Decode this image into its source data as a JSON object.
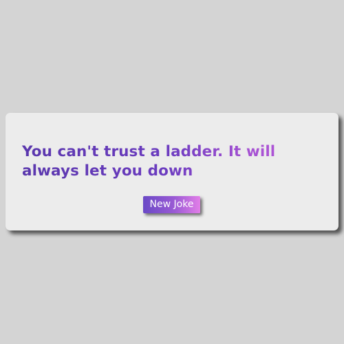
{
  "joke": {
    "text": "You can't trust a ladder. It will always let you down"
  },
  "actions": {
    "new_joke_label": "New Joke"
  },
  "colors": {
    "background": "#d4d4d4",
    "card": "#ececec",
    "text_gradient_start": "#5a37ad",
    "text_gradient_end": "#bd58dc",
    "button_gradient_start": "#6a49c6",
    "button_gradient_end": "#e27ee8"
  }
}
